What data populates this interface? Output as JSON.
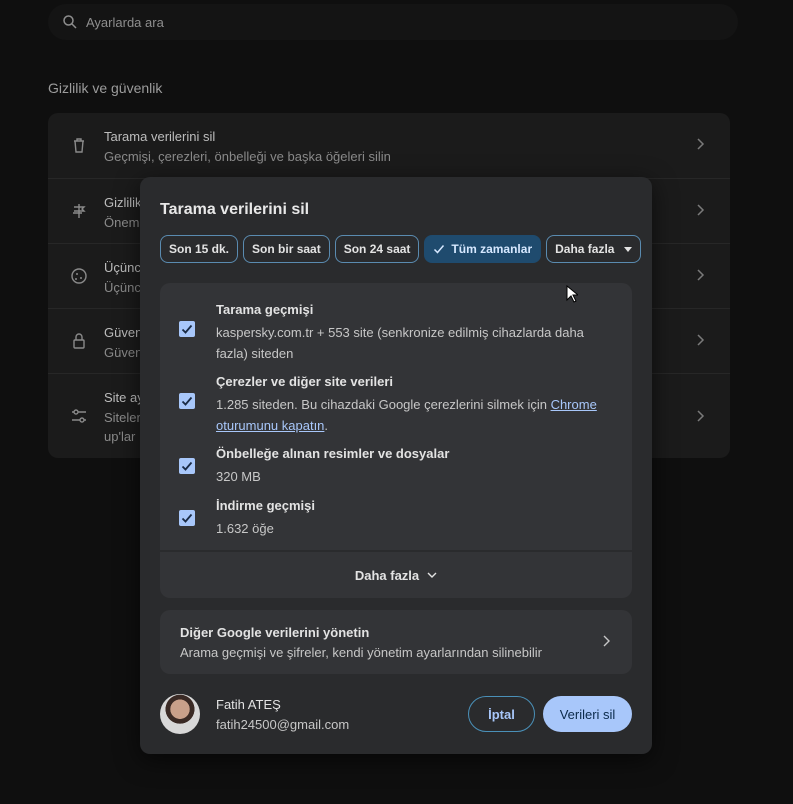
{
  "search": {
    "placeholder": "Ayarlarda ara"
  },
  "section": {
    "title": "Gizlilik ve güvenlik"
  },
  "background_rows": [
    {
      "title": "Tarama verilerini sil",
      "desc": "Geçmişi, çerezleri, önbelleği ve başka öğeleri silin",
      "icon": "trash-icon"
    },
    {
      "title": "Gizlilik",
      "desc": "Önem",
      "icon": "privacy-guide-icon"
    },
    {
      "title": "Üçüncü",
      "desc": "Üçünc",
      "icon": "cookie-icon"
    },
    {
      "title": "Güven",
      "desc": "Güven",
      "icon": "lock-icon"
    },
    {
      "title": "Site ay",
      "desc": "Siteler",
      "desc2": "up'lar",
      "icon": "tune-icon"
    }
  ],
  "dialog": {
    "title": "Tarama verilerini sil",
    "time_chips": [
      {
        "label": "Son 15 dk.",
        "selected": false
      },
      {
        "label": "Son bir saat",
        "selected": false
      },
      {
        "label": "Son 24 saat",
        "selected": false
      },
      {
        "label": "Tüm zamanlar",
        "selected": true
      },
      {
        "label": "Daha fazla",
        "selected": false,
        "dropdown": true
      }
    ],
    "options": [
      {
        "title": "Tarama geçmişi",
        "desc": "kaspersky.com.tr + 553 site (senkronize edilmiş cihazlarda daha fazla) siteden",
        "checked": true
      },
      {
        "title": "Çerezler ve diğer site verileri",
        "desc": "1.285 siteden. Bu cihazdaki Google çerezlerini silmek için ",
        "link": "Chrome oturumunu kapatın",
        "desc_suffix": ".",
        "checked": true
      },
      {
        "title": "Önbelleğe alınan resimler ve dosyalar",
        "desc": "320 MB",
        "checked": true
      },
      {
        "title": "İndirme geçmişi",
        "desc": "1.632 öğe",
        "checked": true
      }
    ],
    "more_label": "Daha fazla",
    "google_data": {
      "title": "Diğer Google verilerini yönetin",
      "desc": "Arama geçmişi ve şifreler, kendi yönetim ayarlarından silinebilir"
    },
    "account": {
      "name": "Fatih ATEŞ",
      "email": "fatih24500@gmail.com"
    },
    "cancel_label": "İptal",
    "delete_label": "Verileri sil"
  },
  "colors": {
    "accent": "#a8c7fa",
    "selected_chip": "#1f4b6e",
    "dialog_bg": "#2a2b2d"
  }
}
